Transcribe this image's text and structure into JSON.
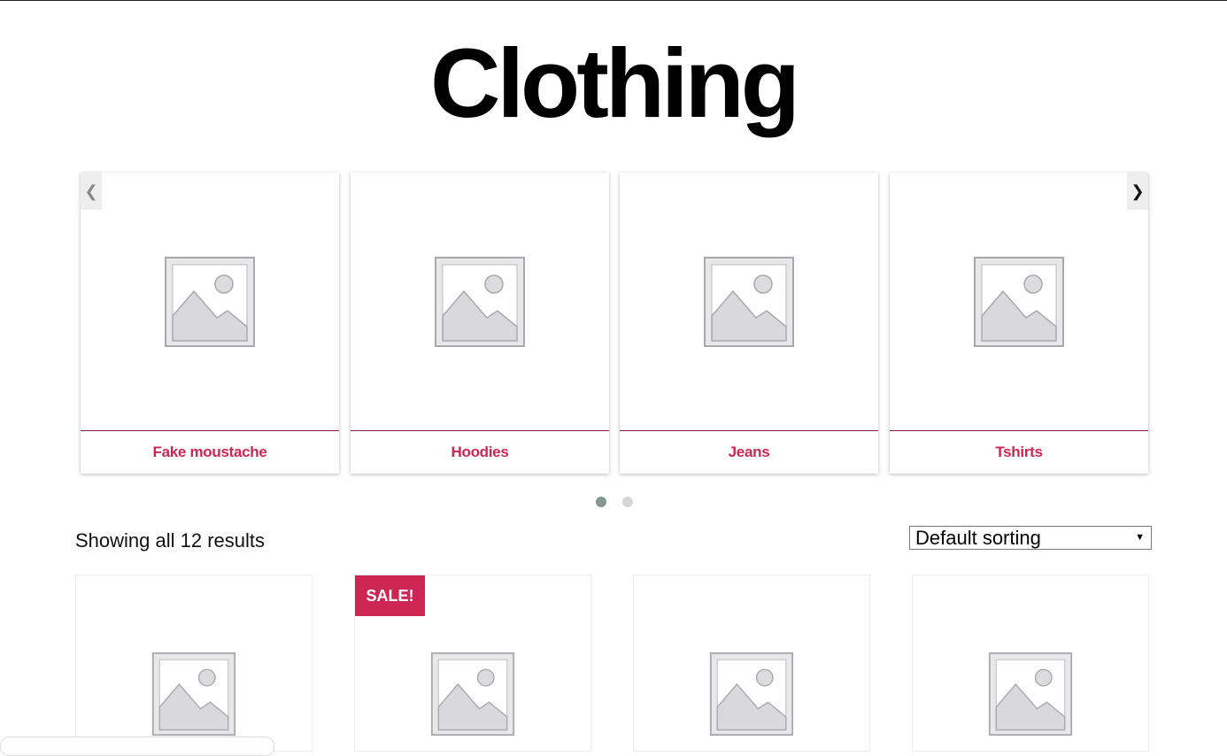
{
  "page": {
    "title": "Clothing"
  },
  "carousel": {
    "prev_glyph": "❮",
    "next_glyph": "❯",
    "categories": [
      {
        "name": "Fake moustache"
      },
      {
        "name": "Hoodies"
      },
      {
        "name": "Jeans"
      },
      {
        "name": "Tshirts"
      }
    ],
    "pages": 2,
    "current_page": 1
  },
  "shop": {
    "result_count": "Showing all 12 results",
    "sort_selected": "Default sorting",
    "sale_label": "SALE!"
  },
  "colors": {
    "accent": "#cd2653",
    "dot_active": "#869791",
    "dot_inactive": "#d6d6d6"
  },
  "icons": {
    "placeholder": "image-placeholder-icon",
    "prev": "chevron-left-icon",
    "next": "chevron-right-icon",
    "dropdown": "caret-down-icon"
  }
}
